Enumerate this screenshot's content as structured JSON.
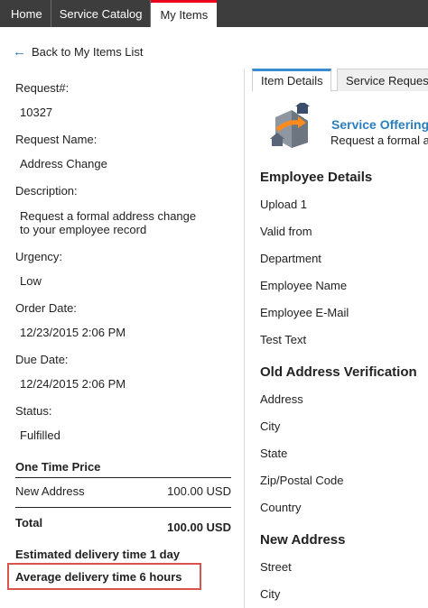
{
  "nav": {
    "home": "Home",
    "catalog": "Service Catalog",
    "my_items": "My Items"
  },
  "back_label": "Back to My Items List",
  "request": {
    "request_num_label": "Request#:",
    "request_num": "10327",
    "name_label": "Request Name:",
    "name": "Address Change",
    "desc_label": "Description:",
    "desc_line1": "Request a formal address change",
    "desc_line2": "to your employee record",
    "urgency_label": "Urgency:",
    "urgency": "Low",
    "order_label": "Order Date:",
    "order_date": "12/23/2015 2:06 PM",
    "due_label": "Due Date:",
    "due_date": "12/24/2015 2:06 PM",
    "status_label": "Status:",
    "status": "Fulfilled"
  },
  "pricing": {
    "heading": "One Time Price",
    "item_name": "New Address",
    "item_price": "100.00 USD",
    "total_label": "Total",
    "total_price": "100.00 USD",
    "estimated": "Estimated delivery time 1 day",
    "average": "Average delivery time 6 hours"
  },
  "tabs": {
    "item_details": "Item Details",
    "service_request": "Service Reques"
  },
  "offering": {
    "title": "Service Offering",
    "desc": "Request a formal a"
  },
  "sections": {
    "employee": {
      "heading": "Employee Details",
      "fields": [
        "Upload 1",
        "Valid from",
        "Department",
        "Employee Name",
        "Employee E-Mail",
        "Test Text"
      ]
    },
    "old_address": {
      "heading": "Old Address Verification",
      "fields": [
        "Address",
        "City",
        "State",
        "Zip/Postal Code",
        "Country"
      ]
    },
    "new_address": {
      "heading": "New Address",
      "fields": [
        "Street",
        "City"
      ]
    }
  }
}
